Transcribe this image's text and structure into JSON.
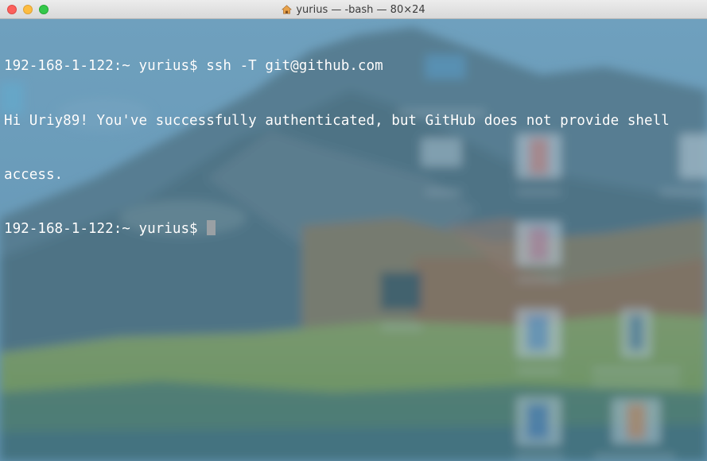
{
  "window": {
    "title": "yurius — -bash — 80×24",
    "title_icon": "home-icon"
  },
  "traffic_lights": {
    "close_color": "#fc605c",
    "minimize_color": "#fdbc40",
    "maximize_color": "#34c84a"
  },
  "terminal": {
    "lines": [
      {
        "prompt": "192-168-1-122:~ yurius$",
        "command": " ssh -T git@github.com"
      },
      {
        "text": "Hi Uriy89! You've successfully authenticated, but GitHub does not provide shell"
      },
      {
        "text": "access."
      },
      {
        "prompt": "192-168-1-122:~ yurius$",
        "command": " "
      }
    ],
    "text_color": "#ffffff",
    "cursor_color": "#9aa0a4"
  }
}
